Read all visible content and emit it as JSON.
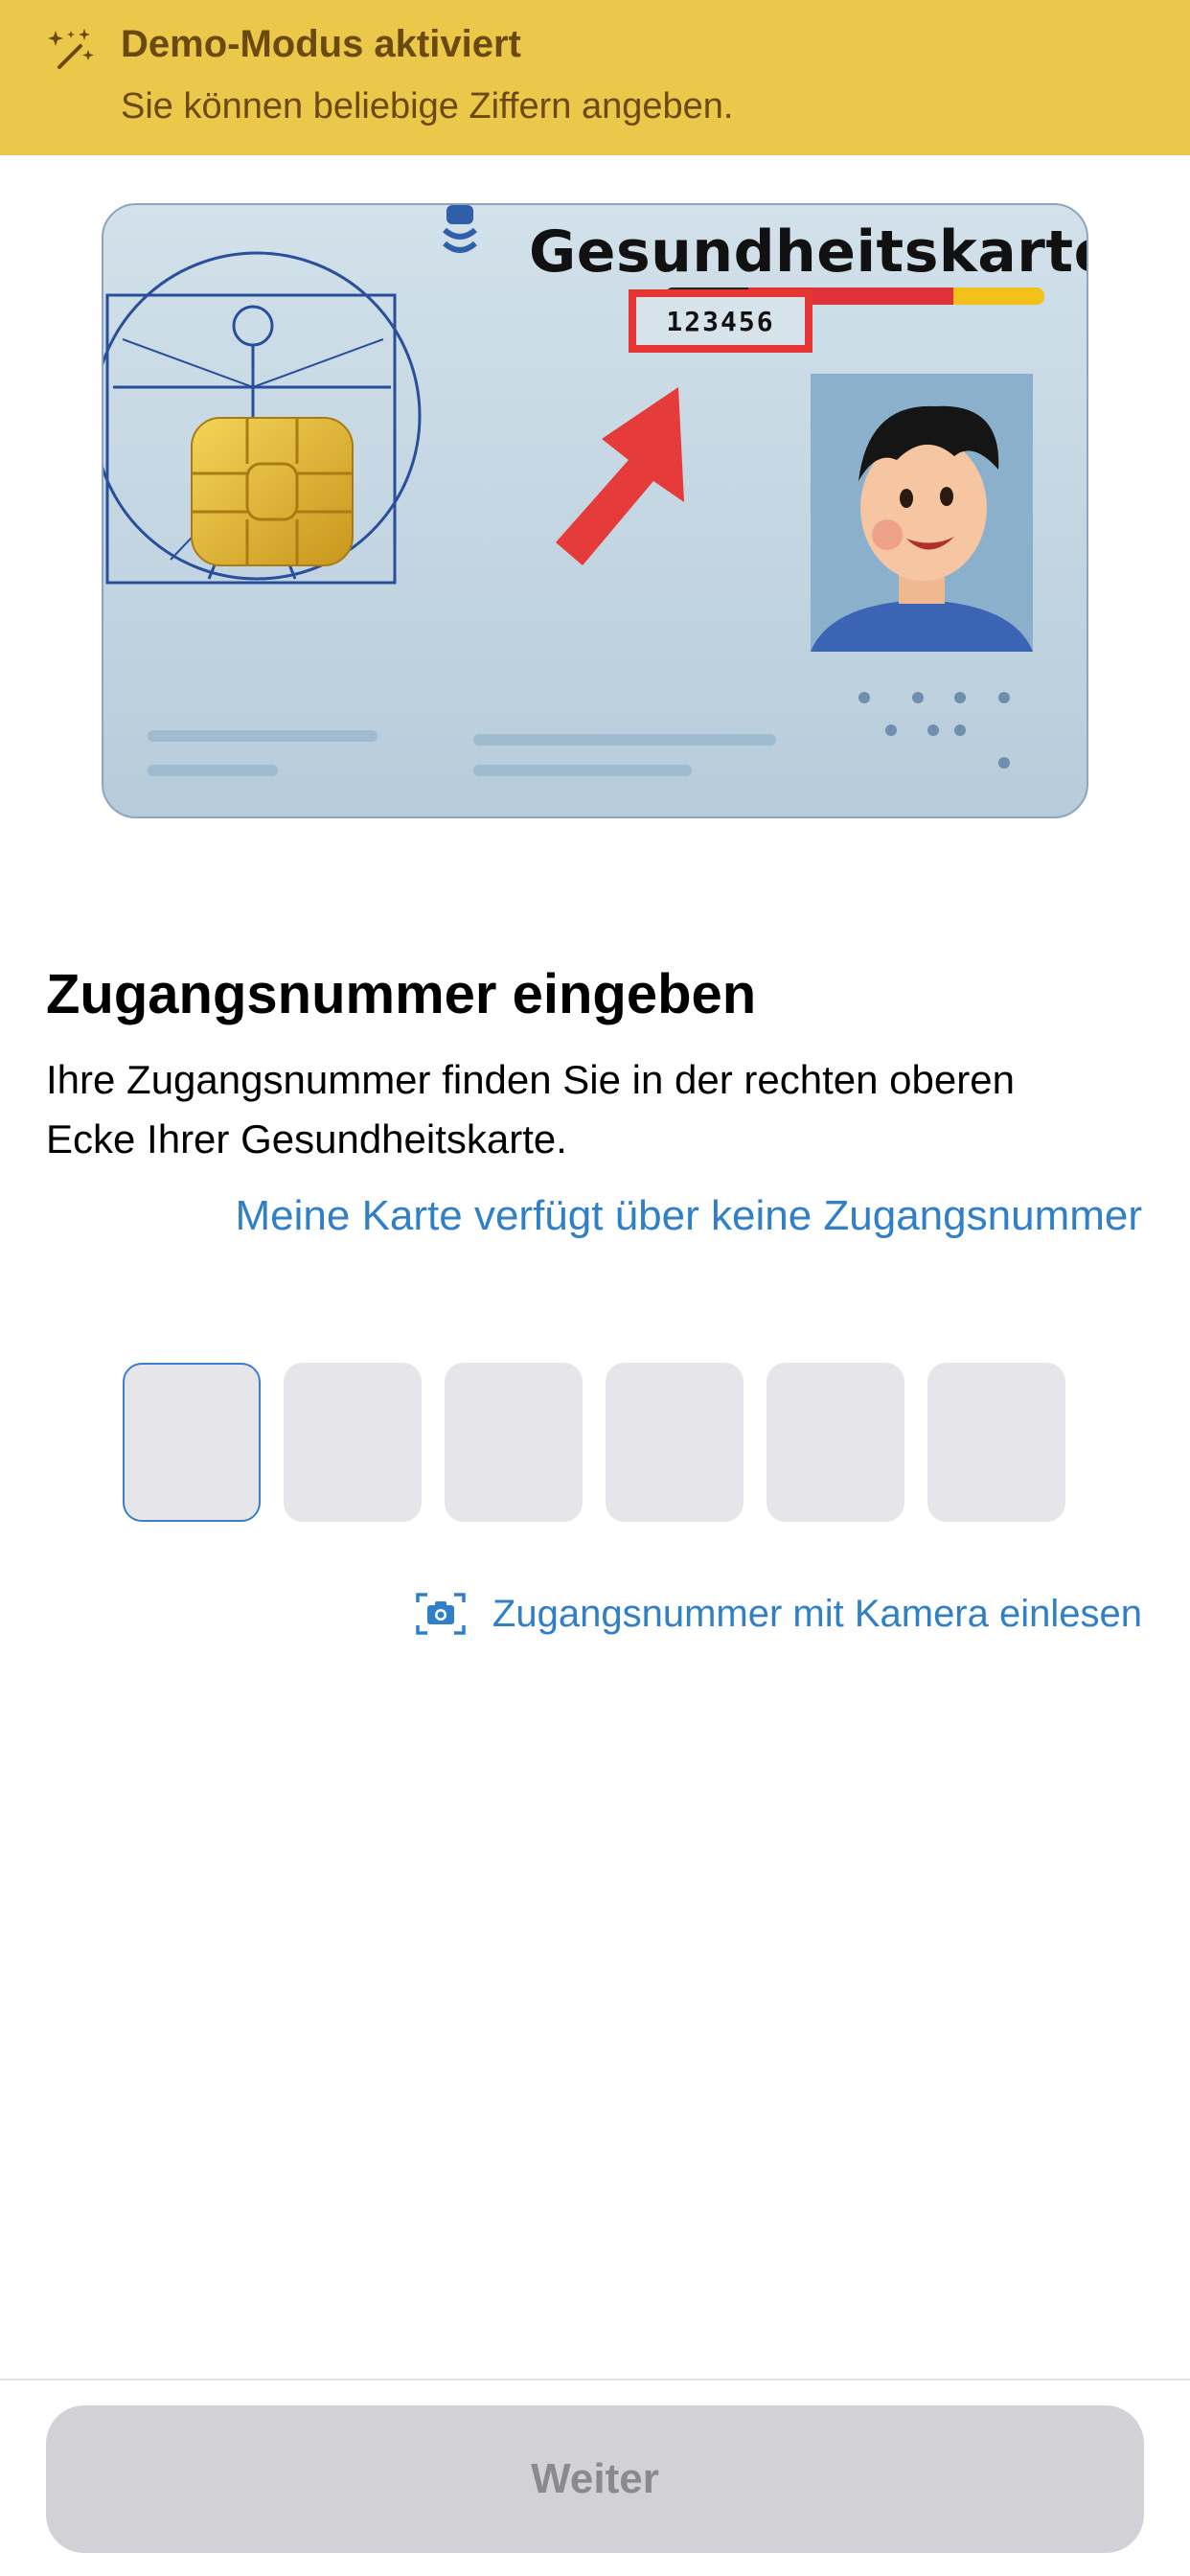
{
  "banner": {
    "icon": "magic-wand-sparkles-icon",
    "title": "Demo-Modus aktiviert",
    "subtitle": "Sie können beliebige Ziffern angeben."
  },
  "card": {
    "title": "Gesundheitskarte",
    "access_number": "123456",
    "highlight_color": "#e53434"
  },
  "main": {
    "heading": "Zugangsnummer eingeben",
    "description": "Ihre Zugangsnummer finden Sie in der rechten oberen Ecke Ihrer Gesundheitskarte.",
    "no_number_link": "Meine Karte verfügt über keine Zugangsnummer"
  },
  "pin": {
    "digits": [
      "",
      "",
      "",
      "",
      "",
      ""
    ],
    "active_index": 0
  },
  "camera": {
    "icon": "camera-icon",
    "label": "Zugangsnummer mit Kamera einlesen"
  },
  "footer": {
    "continue_label": "Weiter"
  },
  "colors": {
    "banner_bg": "#ecc84a",
    "banner_text": "#6b4a12",
    "link": "#2f7fc9",
    "button_disabled_bg": "#d2d2d6",
    "button_disabled_text": "#8a8a8e"
  }
}
